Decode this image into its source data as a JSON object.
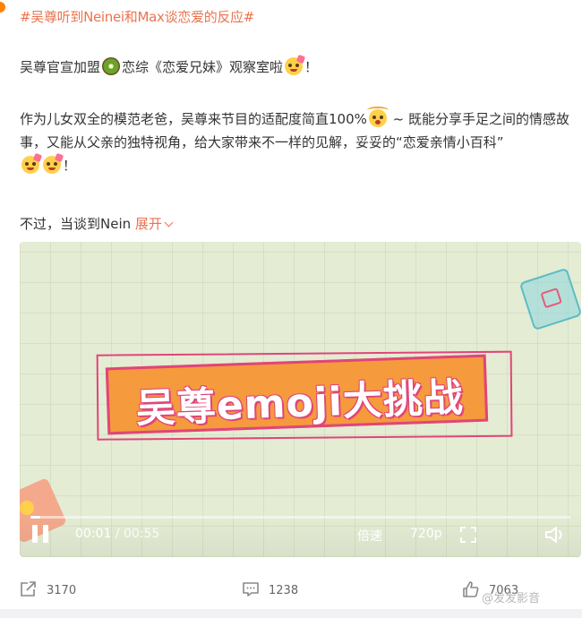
{
  "post": {
    "hashtag": "#吴尊听到Neinei和Max谈恋爱的反应#",
    "para1_a": "吴尊官宣加盟",
    "para1_b": "恋综《恋爱兄妹》观察室啦",
    "para1_end": "！",
    "para2_a": "作为儿女双全的模范老爸，吴尊来节目的适配度简直100%",
    "para2_b": " ~ 既能分享手足之间的情感故事，又能从父亲的独特视角，给大家带来不一样的见解，妥妥的“恋爱亲情小百科”",
    "para2_end": "！",
    "para3": "不过，当谈到Nein",
    "expand_label": "展开",
    "emojis": [
      "kiwi-emoji",
      "party-face-emoji",
      "star-struck-emoji",
      "party-face-emoji",
      "party-face-emoji"
    ]
  },
  "video": {
    "banner_text": "吴尊emoji大挑战",
    "current_time": "00:01",
    "separator": "/",
    "duration": "00:55",
    "progress_fraction": 0.018,
    "speed_label": "倍速",
    "quality_label": "720p",
    "controls_icons": [
      "pause-icon",
      "fullscreen-icon",
      "volume-icon"
    ]
  },
  "footer": {
    "repost_count": "3170",
    "comment_count": "1238",
    "like_count": "7063",
    "watermark": "@发发影音"
  },
  "colors": {
    "accent": "#eb7350",
    "text": "#333333",
    "banner_fill": "#f59a3d",
    "banner_border": "#e0457a",
    "video_bg": "#e4ecd4"
  }
}
